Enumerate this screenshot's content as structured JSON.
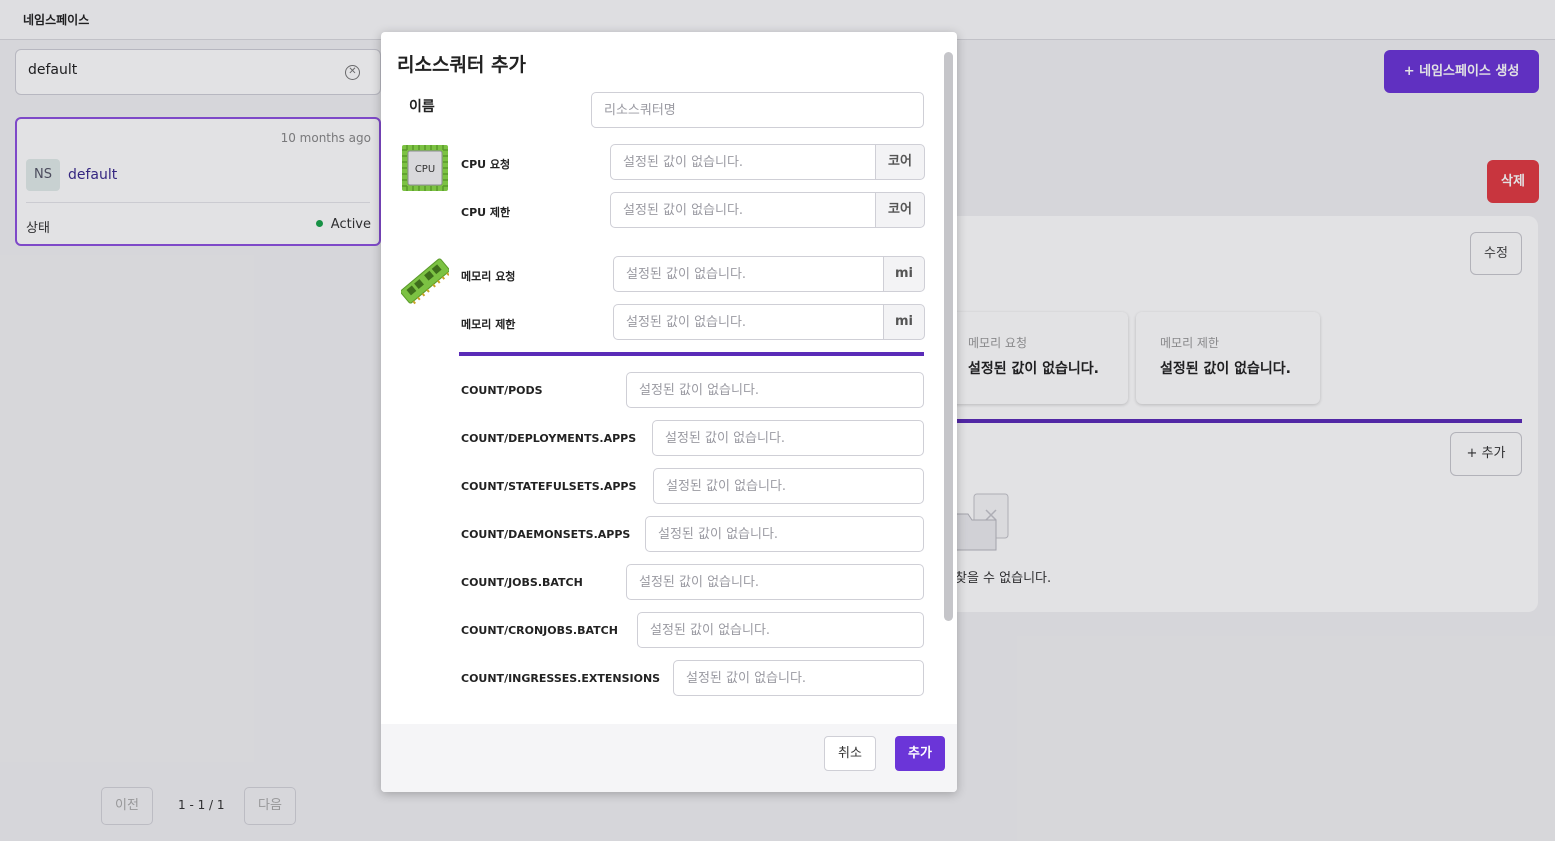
{
  "topbar": {
    "breadcrumb": "네임스페이스"
  },
  "left": {
    "search": {
      "value": "default"
    },
    "card": {
      "time": "10 months ago",
      "badge": "NS",
      "name": "default",
      "state_label": "상태",
      "state": "Active"
    },
    "pager": {
      "prev": "이전",
      "info": "1 - 1 / 1",
      "next": "다음"
    }
  },
  "right": {
    "create_button": "+ 네임스페이스 생성",
    "delete_button": "삭제",
    "edit_button": "수정",
    "summaries": [
      {
        "label": "메모리 요청",
        "value": "설정된 값이 없습니다."
      },
      {
        "label": "메모리 제한",
        "value": "설정된 값이 없습니다."
      }
    ],
    "add_button": "+ 추가",
    "empty_text": "찾을 수 없습니다."
  },
  "modal": {
    "title": "리소스쿼터 추가",
    "name_label": "이름",
    "name_placeholder": "리소스쿼터명",
    "cpu_icon_text": "CPU",
    "cpu": [
      {
        "label": "CPU 요청",
        "placeholder": "설정된 값이 없습니다.",
        "unit": "코어"
      },
      {
        "label": "CPU 제한",
        "placeholder": "설정된 값이 없습니다.",
        "unit": "코어"
      }
    ],
    "memory": [
      {
        "label": "메모리 요청",
        "placeholder": "설정된 값이 없습니다.",
        "unit": "mi"
      },
      {
        "label": "메모리 제한",
        "placeholder": "설정된 값이 없습니다.",
        "unit": "mi"
      }
    ],
    "counts": [
      {
        "label": "COUNT/PODS",
        "placeholder": "설정된 값이 없습니다."
      },
      {
        "label": "COUNT/DEPLOYMENTS.APPS",
        "placeholder": "설정된 값이 없습니다."
      },
      {
        "label": "COUNT/STATEFULSETS.APPS",
        "placeholder": "설정된 값이 없습니다."
      },
      {
        "label": "COUNT/DAEMONSETS.APPS",
        "placeholder": "설정된 값이 없습니다."
      },
      {
        "label": "COUNT/JOBS.BATCH",
        "placeholder": "설정된 값이 없습니다."
      },
      {
        "label": "COUNT/CRONJOBS.BATCH",
        "placeholder": "설정된 값이 없습니다."
      },
      {
        "label": "COUNT/INGRESSES.EXTENSIONS",
        "placeholder": "설정된 값이 없습니다."
      }
    ],
    "cancel_button": "취소",
    "add_button": "추가"
  },
  "colors": {
    "accent": "#6b35d8",
    "danger": "#e23b42",
    "active": "#19a34a",
    "divider": "#5a2bb8"
  }
}
